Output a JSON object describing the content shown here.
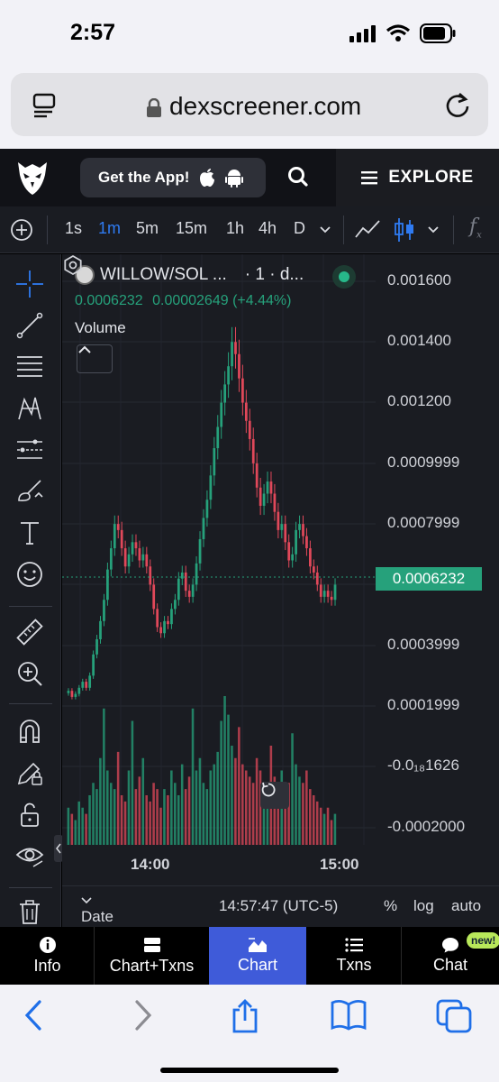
{
  "status_bar": {
    "time": "2:57"
  },
  "browser": {
    "url": "dexscreener.com"
  },
  "header": {
    "get_app_label": "Get the App!",
    "explore_label": "EXPLORE"
  },
  "timeframes": [
    "1s",
    "1m",
    "5m",
    "15m",
    "1h",
    "4h",
    "D"
  ],
  "active_timeframe": "1m",
  "chart": {
    "pair_label": "WILLOW/SOL ...",
    "interval_label": "· 1 · d...",
    "ohlc_price": "0.0006232",
    "ohlc_change": "0.00002649 (+4.44%)",
    "volume_label": "Volume",
    "current_price_tag": "0.0006232",
    "bottom": {
      "date_range": "Date Range",
      "timestamp": "14:57:47 (UTC-5)",
      "percent": "%",
      "log": "log",
      "auto": "auto"
    }
  },
  "chart_data": {
    "type": "candlestick",
    "title": "WILLOW/SOL",
    "y_tick_labels": [
      "0.001600",
      "0.001400",
      "0.001200",
      "0.0009999",
      "0.0007999",
      "0.0006232",
      "0.0003999",
      "0.0001999",
      "-0.0₁₈1626",
      "-0.0002000"
    ],
    "x_tick_labels": [
      "14:00",
      "15:00"
    ],
    "ylim": [
      2e-05,
      0.0016
    ],
    "price_close": [
      0.00025,
      0.00023,
      0.00024,
      0.00026,
      0.00028,
      0.00026,
      0.0003,
      0.00037,
      0.00042,
      0.00048,
      0.00055,
      0.00065,
      0.00072,
      0.0008,
      0.00078,
      0.00072,
      0.00066,
      0.0007,
      0.00074,
      0.00072,
      0.00068,
      0.0007,
      0.00066,
      0.0006,
      0.00052,
      0.00046,
      0.00044,
      0.00048,
      0.00047,
      0.00052,
      0.00055,
      0.00062,
      0.00064,
      0.00058,
      0.00056,
      0.0006,
      0.00067,
      0.00075,
      0.00082,
      0.00088,
      0.00096,
      0.00105,
      0.00112,
      0.0012,
      0.00126,
      0.00132,
      0.0014,
      0.00136,
      0.00128,
      0.0012,
      0.00114,
      0.00108,
      0.001,
      0.00092,
      0.00086,
      0.0009,
      0.00094,
      0.0009,
      0.00084,
      0.00078,
      0.0008,
      0.00074,
      0.00068,
      0.0007,
      0.00078,
      0.0008,
      0.00076,
      0.00072,
      0.00066,
      0.00064,
      0.0006,
      0.00056,
      0.00058,
      0.00056,
      0.00055,
      0.0006
    ],
    "volume": [
      6,
      5,
      4,
      7,
      6,
      5,
      8,
      10,
      9,
      14,
      22,
      12,
      10,
      9,
      15,
      8,
      7,
      12,
      20,
      9,
      11,
      14,
      8,
      7,
      10,
      9,
      6,
      9,
      8,
      12,
      10,
      8,
      13,
      9,
      11,
      22,
      12,
      14,
      10,
      9,
      12,
      13,
      15,
      20,
      24,
      21,
      16,
      14,
      19,
      13,
      12,
      11,
      10,
      14,
      12,
      9,
      10,
      16,
      11,
      8,
      12,
      9,
      10,
      18,
      13,
      11,
      10,
      12,
      9,
      8,
      7,
      6,
      5,
      6,
      4,
      5
    ]
  },
  "tabs": [
    {
      "label": "Info",
      "icon": "info-icon"
    },
    {
      "label": "Chart+Txns",
      "icon": "chart-txns-icon"
    },
    {
      "label": "Chart",
      "icon": "chart-icon",
      "active": true
    },
    {
      "label": "Txns",
      "icon": "list-icon"
    },
    {
      "label": "Chat",
      "icon": "chat-icon",
      "badge": "new!"
    }
  ],
  "colors": {
    "up": "#26a17b",
    "down": "#e0485a",
    "accent": "#2f7bf2",
    "active_tab": "#3f5bd9"
  }
}
